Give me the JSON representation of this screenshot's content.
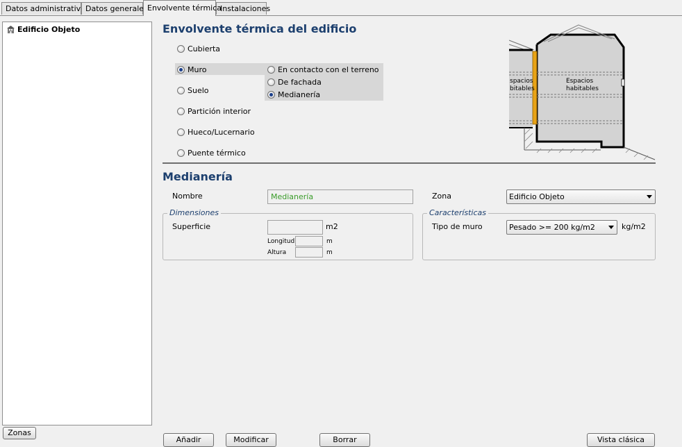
{
  "tabs": [
    {
      "label": "Datos administrativos"
    },
    {
      "label": "Datos generales"
    },
    {
      "label": "Envolvente térmica"
    },
    {
      "label": "Instalaciones"
    }
  ],
  "tree": {
    "root_label": "Edificio Objeto"
  },
  "buttons": {
    "zonas": "Zonas",
    "anadir": "Añadir",
    "modificar": "Modificar",
    "borrar": "Borrar",
    "vista_clasica": "Vista clásica"
  },
  "envolvente": {
    "title": "Envolvente térmica del edificio",
    "types": [
      {
        "label": "Cubierta",
        "selected": false
      },
      {
        "label": "Muro",
        "selected": true
      },
      {
        "label": "Suelo",
        "selected": false
      },
      {
        "label": "Partición interior",
        "selected": false
      },
      {
        "label": "Hueco/Lucernario",
        "selected": false
      },
      {
        "label": "Puente térmico",
        "selected": false
      }
    ],
    "muro_subtypes": [
      {
        "label": "En contacto con el terreno",
        "selected": false
      },
      {
        "label": "De fachada",
        "selected": false
      },
      {
        "label": "Medianería",
        "selected": true
      }
    ]
  },
  "diagram": {
    "left_label": "spacios\nbitables",
    "right_label": "Espacios\nhabitables",
    "accent_color": "#e8a317"
  },
  "form": {
    "title": "Medianería",
    "nombre_label": "Nombre",
    "nombre_value": "Medianería",
    "nombre_color": "#3a9c2a",
    "zona_label": "Zona",
    "zona_value": "Edificio Objeto",
    "dimensiones": {
      "legend": "Dimensiones",
      "superficie_label": "Superficie",
      "superficie_value": "",
      "superficie_unit": "m2",
      "longitud_label": "Longitud",
      "longitud_value": "",
      "longitud_unit": "m",
      "altura_label": "Altura",
      "altura_value": "",
      "altura_unit": "m"
    },
    "caracteristicas": {
      "legend": "Características",
      "tipo_label": "Tipo de muro",
      "tipo_value": "Pesado >= 200 kg/m2",
      "tipo_unit": "kg/m2"
    }
  }
}
